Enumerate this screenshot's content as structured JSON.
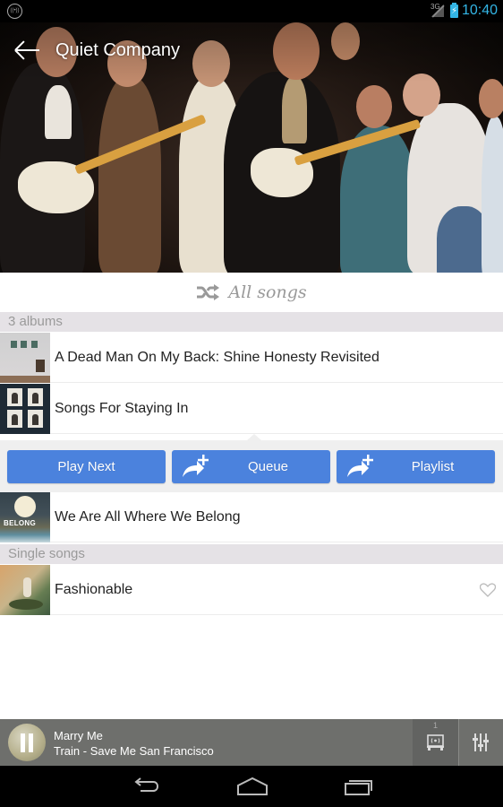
{
  "status_bar": {
    "network": "3G",
    "time": "10:40",
    "left_icon": "wireless-icon",
    "accent_color": "#33b5e5"
  },
  "header": {
    "title": "Quiet Company",
    "back_icon": "back-arrow-icon"
  },
  "all_songs": {
    "label": "All songs",
    "icon": "shuffle-icon"
  },
  "albums_section": {
    "header": "3 albums",
    "items": [
      {
        "title": "A Dead Man On My Back: Shine Honesty Revisited"
      },
      {
        "title": "Songs For Staying In"
      },
      {
        "title": "We Are All Where We Belong"
      }
    ]
  },
  "actions": {
    "play_next": "Play Next",
    "queue": "Queue",
    "playlist": "Playlist",
    "button_color": "#4b82dd"
  },
  "singles_section": {
    "header": "Single songs",
    "items": [
      {
        "title": "Fashionable",
        "favorite": false
      }
    ]
  },
  "now_playing": {
    "title": "Marry Me",
    "subtitle": "Train - Save Me San Francisco",
    "cast_count": "1",
    "state": "playing"
  },
  "album_art_text": {
    "we_are_all": "BELONG"
  }
}
